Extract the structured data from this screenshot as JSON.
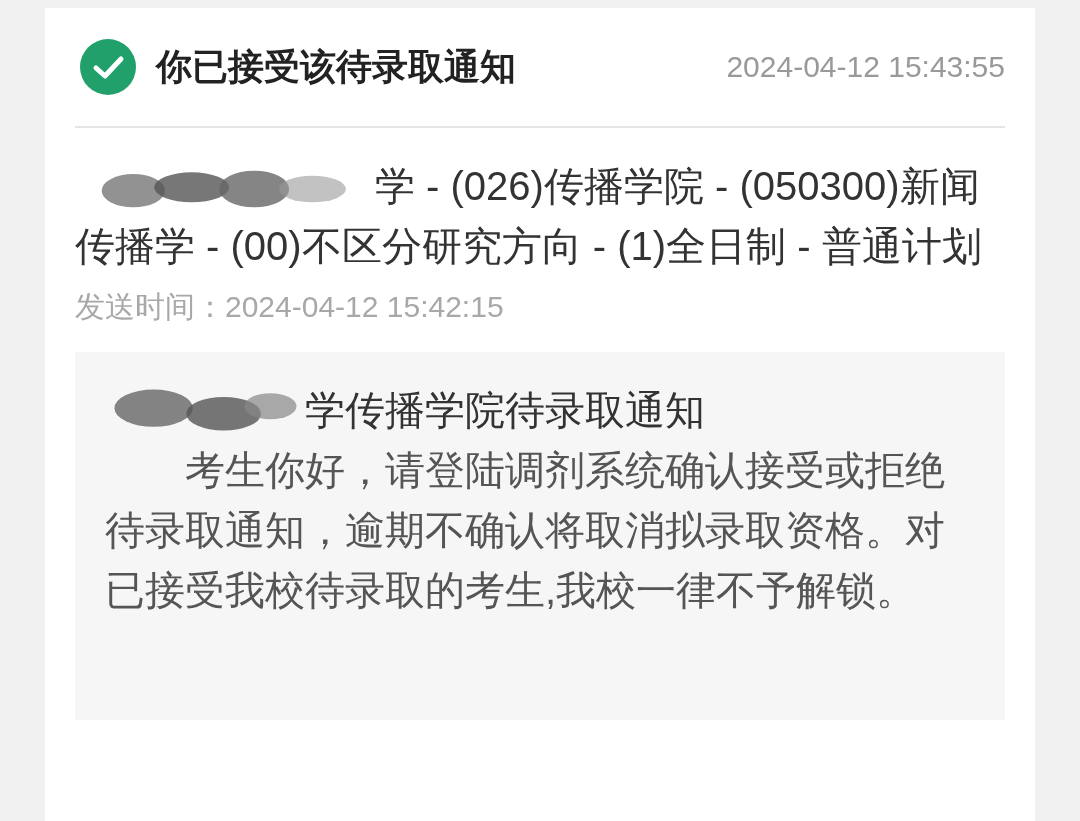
{
  "header": {
    "accepted": true,
    "title": "你已接受该待录取通知",
    "time": "2024-04-12 15:43:55"
  },
  "program": {
    "redacted": true,
    "text": "学 - (026)传播学院 - (050300)新闻传播学 - (00)不区分研究方向 - (1)全日制 - 普通计划"
  },
  "sent": {
    "label": "发送时间：",
    "time": "2024-04-12 15:42:15"
  },
  "notice": {
    "title_redacted": true,
    "title": "学传播学院待录取通知",
    "body": "考生你好，请登陆调剂系统确认接受或拒绝待录取通知，逾期不确认将取消拟录取资格。对已接受我校待录取的考生,我校一律不予解锁。"
  }
}
